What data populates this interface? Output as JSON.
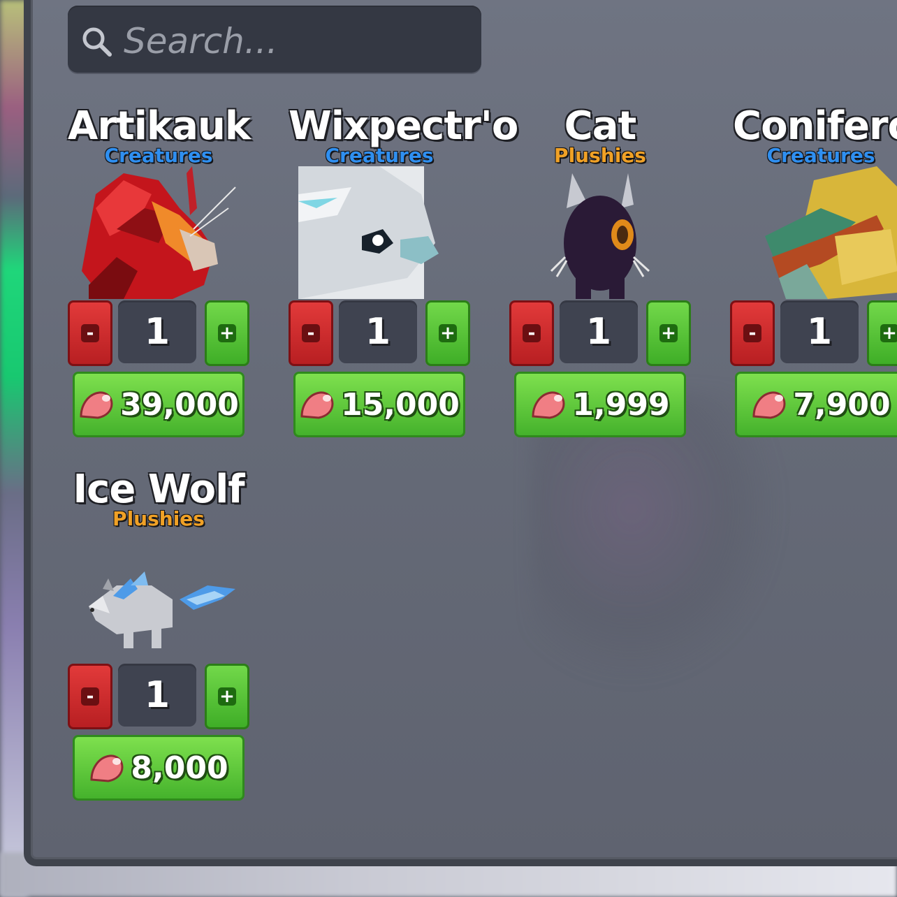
{
  "search": {
    "placeholder": "Search..."
  },
  "currency_icon": "meat-icon",
  "items": [
    {
      "name": "Artikauk",
      "category": "Creatures",
      "quantity": "1",
      "price": "39,000",
      "minus": "-",
      "plus": "+"
    },
    {
      "name": "Wixpectr'o",
      "category": "Creatures",
      "quantity": "1",
      "price": "15,000",
      "minus": "-",
      "plus": "+"
    },
    {
      "name": "Cat",
      "category": "Plushies",
      "quantity": "1",
      "price": "1,999",
      "minus": "-",
      "plus": "+"
    },
    {
      "name": "Coniferon",
      "category": "Creatures",
      "quantity": "1",
      "price": "7,900",
      "minus": "-",
      "plus": "+"
    },
    {
      "name": "Ice Wolf",
      "category": "Plushies",
      "quantity": "1",
      "price": "8,000",
      "minus": "-",
      "plus": "+"
    }
  ],
  "colors": {
    "creatures": "#2f8ff0",
    "plushies": "#f0a126",
    "buy_green": "#45b22c",
    "minus_red": "#b81f22"
  }
}
